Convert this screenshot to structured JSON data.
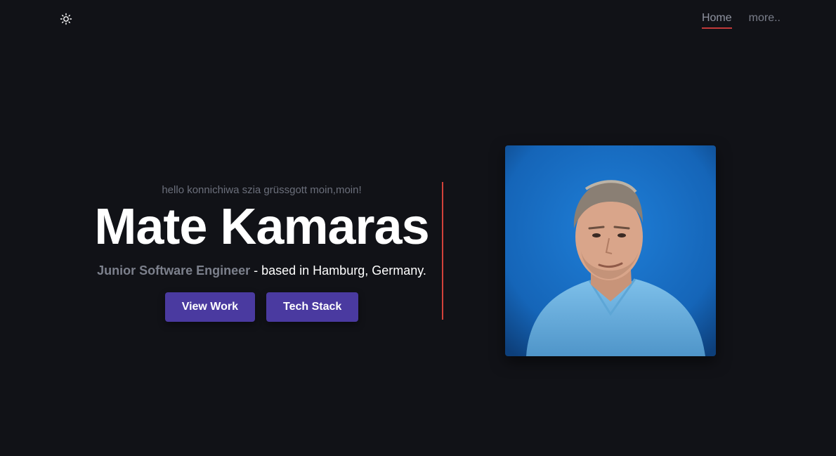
{
  "header": {
    "theme_icon": "sun-icon",
    "nav": [
      {
        "label": "Home",
        "active": true
      },
      {
        "label": "more..",
        "active": false
      }
    ]
  },
  "hero": {
    "greeting": "hello konnichiwa szia grüssgott moin,moin!",
    "name": "Mate Kamaras",
    "role": "Junior Software Engineer",
    "location_text": " - based in Hamburg, Germany.",
    "buttons": {
      "view_work": "View Work",
      "tech_stack": "Tech Stack"
    },
    "portrait_alt": "profile photo"
  },
  "colors": {
    "background": "#111217",
    "accent_button": "#4a3aa0",
    "divider": "#d2413a",
    "nav_underline": "#c23a3a"
  }
}
